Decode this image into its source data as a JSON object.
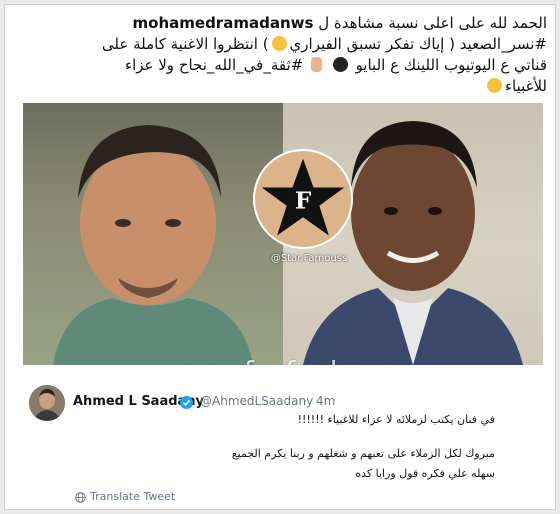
{
  "post": {
    "username": "mohamedramadanws",
    "caption_line1": "الحمد لله على اعلى نسبة مشاهدة ل",
    "caption_line2a": "#نسر_الصعيد ( إياك تفكر تسبق الفيراري",
    "caption_line2b": ") انتظروا الاغنية كاملة على",
    "caption_line3a": "قناتي ع اليوتيوب اللينك ع البايو",
    "caption_line3b": "#ثقة_في_الله_نجاح ولا عزاء",
    "caption_line4": "للأغبياء"
  },
  "image": {
    "logo_letter": "F",
    "logo_handle": "@Star.Famouss",
    "watermark": "www.farfesh.com"
  },
  "tweet": {
    "name": "Ahmed L Saadany",
    "handle": "@AhmedLSaadany",
    "separator": "·",
    "time": "4m",
    "line1": "في فنان يكتب لزملائه لا عزاء للاغبياء !!!!!!",
    "line2": "مبروك لكل الزملاء على تعبهم و شغلهم و ربنا يكرم الجميع",
    "line3": "سهله علي فكره قول ورايا كده",
    "translate_label": "Translate Tweet"
  },
  "colors": {
    "verified": "#1da1f2",
    "secondary_text": "#657786",
    "primary_text": "#14171a"
  },
  "icons": [
    "winking-face-emoji",
    "bomb-emoji",
    "pointing-hand-emoji",
    "tongue-face-emoji",
    "verified-badge-icon",
    "globe-icon",
    "star-logo-icon"
  ]
}
